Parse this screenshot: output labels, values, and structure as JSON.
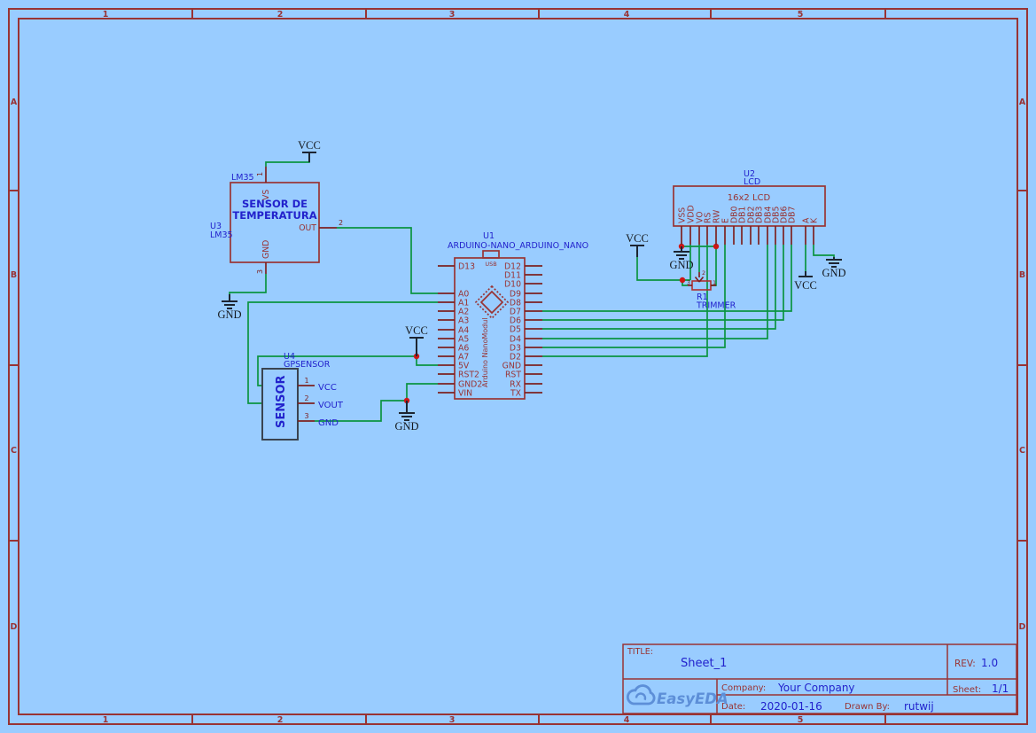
{
  "sheet": {
    "background": "#99ccff",
    "frame_color": "#993333",
    "wire_color": "#0a9440",
    "junction_color": "#cf1616",
    "column_labels": [
      "1",
      "2",
      "3",
      "4",
      "5"
    ],
    "row_labels": [
      "A",
      "B",
      "C",
      "D"
    ]
  },
  "net_flags": {
    "vcc": "VCC",
    "gnd": "GND"
  },
  "components": {
    "lm35": {
      "top_label": "LM35",
      "ref": "U3",
      "value": "LM35",
      "title_line1": "SENSOR DE",
      "title_line2": "TEMPERATURA",
      "pin_vs": {
        "num": "1",
        "name": "VS"
      },
      "pin_out": {
        "num": "2",
        "name": "OUT"
      },
      "pin_gnd": {
        "num": "3",
        "name": "GND"
      }
    },
    "arduino": {
      "ref": "U1",
      "value": "ARDUINO-NANO_ARDUINO_NANO",
      "usb_label": "USB",
      "body_label": "Arduino NanoModul",
      "left_pins": [
        "D13",
        "A0",
        "A1",
        "A2",
        "A3",
        "A4",
        "A5",
        "A6",
        "A7",
        "5V",
        "RST2",
        "GND2",
        "VIN"
      ],
      "right_pins": [
        "D12",
        "D11",
        "D10",
        "D9",
        "D8",
        "D7",
        "D6",
        "D5",
        "D4",
        "D3",
        "D2",
        "GND",
        "RST",
        "RX",
        "TX"
      ]
    },
    "lcd": {
      "ref": "U2",
      "value": "LCD",
      "name": "16x2 LCD",
      "pins": [
        "VSS",
        "VDD",
        "VO",
        "RS",
        "RW",
        "E",
        "DB0",
        "DB1",
        "DB2",
        "DB3",
        "DB4",
        "DB5",
        "DB6",
        "DB7",
        "A",
        "K"
      ]
    },
    "gps": {
      "ref": "U4",
      "value": "GPSENSOR",
      "body_label": "SENSOR",
      "pins": [
        {
          "num": "1",
          "name": "VCC"
        },
        {
          "num": "2",
          "name": "VOUT"
        },
        {
          "num": "3",
          "name": "GND"
        }
      ]
    },
    "trimmer": {
      "ref": "R1",
      "value": "TRIMMER",
      "pin1": "1",
      "pin2": "2",
      "pin3": "3"
    }
  },
  "title_block": {
    "title_label": "TITLE:",
    "title": "Sheet_1",
    "rev_label": "REV:",
    "rev": "1.0",
    "company_label": "Company:",
    "company": "Your Company",
    "sheet_label": "Sheet:",
    "sheet": "1/1",
    "date_label": "Date:",
    "date": "2020-01-16",
    "drawn_by_label": "Drawn By:",
    "drawn_by": "rutwij",
    "logo_text": "EasyEDA",
    "logo_icon": "cloud-logo-icon"
  }
}
